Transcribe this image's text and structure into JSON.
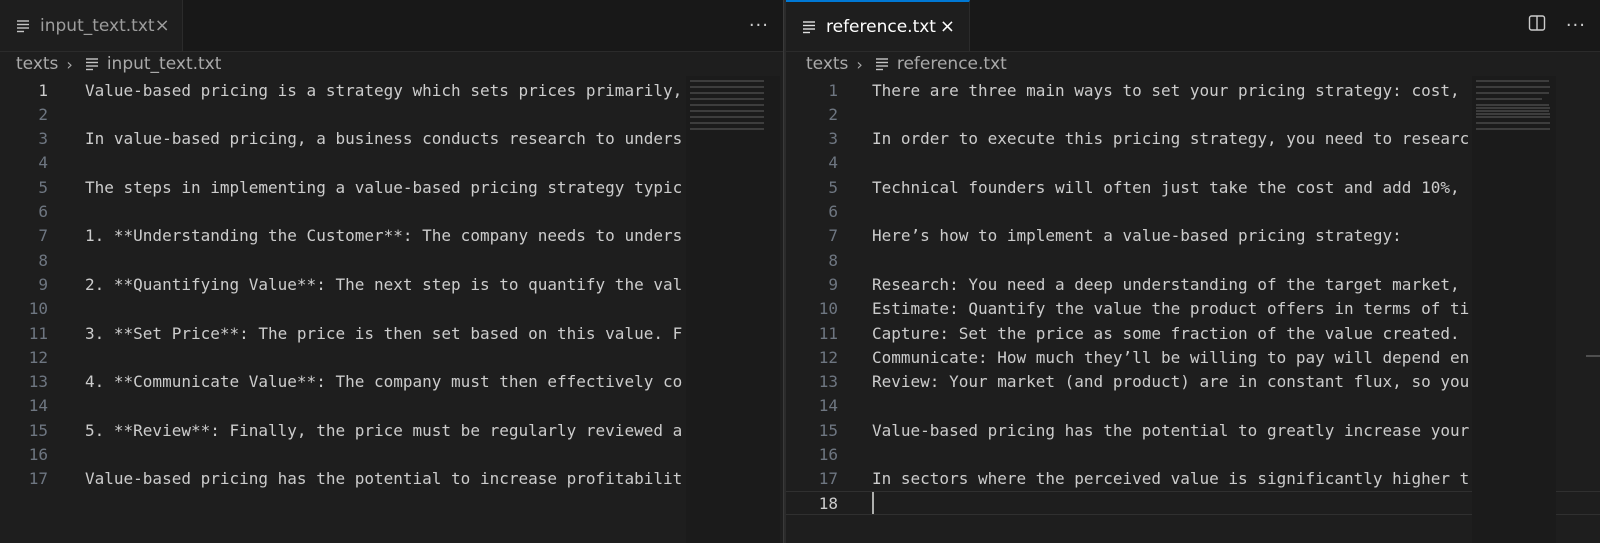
{
  "left": {
    "tab": {
      "label": "input_text.txt",
      "close": "×"
    },
    "actions": {
      "more": "···"
    },
    "breadcrumb": {
      "folder": "texts",
      "file": "input_text.txt"
    },
    "lines": [
      "Value-based pricing is a strategy which sets prices primarily,",
      "",
      "In value-based pricing, a business conducts research to unders",
      "",
      "The steps in implementing a value-based pricing strategy typic",
      "",
      "1. **Understanding the Customer**: The company needs to unders",
      "",
      "2. **Quantifying Value**: The next step is to quantify the val",
      "",
      "3. **Set Price**: The price is then set based on this value. F",
      "",
      "4. **Communicate Value**: The company must then effectively co",
      "",
      "5. **Review**: Finally, the price must be regularly reviewed a",
      "",
      "Value-based pricing has the potential to increase profitabilit"
    ]
  },
  "right": {
    "tab": {
      "label": "reference.txt",
      "close": "×"
    },
    "actions": {
      "split": "◫",
      "more": "···"
    },
    "breadcrumb": {
      "folder": "texts",
      "file": "reference.txt"
    },
    "lines": [
      "There are three main ways to set your pricing strategy: cost,",
      "",
      "In order to execute this pricing strategy, you need to researc",
      "",
      "Technical founders will often just take the cost and add 10%,",
      "",
      "Here’s how to implement a value-based pricing strategy:",
      "",
      "Research: You need a deep understanding of the target market,",
      "Estimate: Quantify the value the product offers in terms of ti",
      "Capture: Set the price as some fraction of the value created.",
      "Communicate: How much they’ll be willing to pay will depend en",
      "Review: Your market (and product) are in constant flux, so you",
      "",
      "Value-based pricing has the potential to greatly increase your",
      "",
      "In sectors where the perceived value is significantly higher t",
      ""
    ]
  },
  "line_numbers": [
    "1",
    "2",
    "3",
    "4",
    "5",
    "6",
    "7",
    "8",
    "9",
    "10",
    "11",
    "12",
    "13",
    "14",
    "15",
    "16",
    "17",
    "18"
  ],
  "colors": {
    "accent": "#0078d4",
    "background": "#1e1e1e"
  },
  "icons": {
    "file": "file-lines-icon",
    "close": "close-icon",
    "split": "split-editor-icon",
    "more": "more-actions-icon",
    "chevron": "chevron-right-icon"
  }
}
